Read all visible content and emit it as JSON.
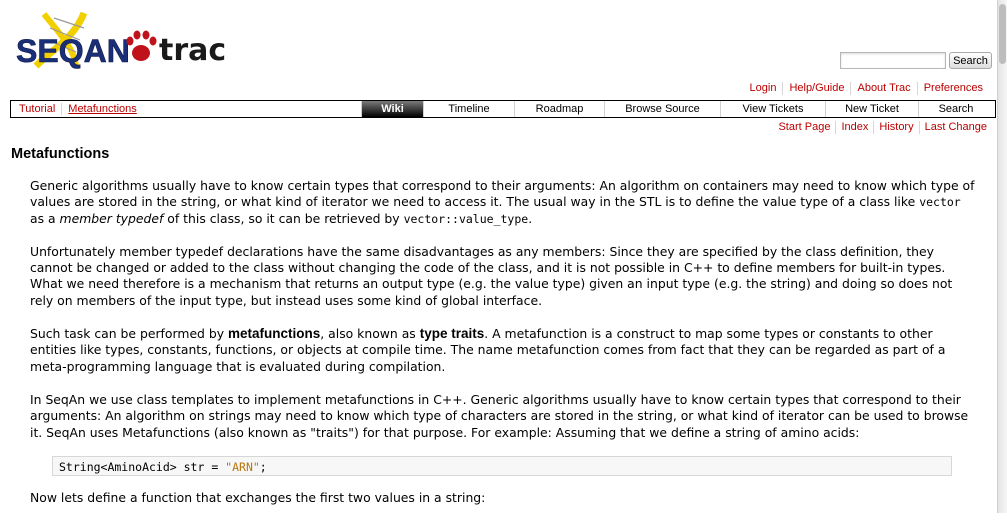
{
  "logo": {
    "text_seqan": "SEQAN",
    "text_trac": "trac"
  },
  "search": {
    "placeholder": "",
    "button_label": "Search"
  },
  "metanav": [
    "Login",
    "Help/Guide",
    "About Trac",
    "Preferences"
  ],
  "mainnav": {
    "left_links": [
      "Tutorial",
      "Metafunctions"
    ],
    "items": [
      {
        "label": "Wiki",
        "active": true
      },
      {
        "label": "Timeline",
        "active": false
      },
      {
        "label": "Roadmap",
        "active": false
      },
      {
        "label": "Browse Source",
        "active": false
      },
      {
        "label": "View Tickets",
        "active": false
      },
      {
        "label": "New Ticket",
        "active": false
      },
      {
        "label": "Search",
        "active": false
      }
    ]
  },
  "ctxtnav": [
    "Start Page",
    "Index",
    "History",
    "Last Change"
  ],
  "page": {
    "title": "Metafunctions",
    "p1_a": "Generic algorithms usually have to know certain types that correspond to their arguments: An algorithm on containers may need to know which type of values are stored in the string, or what kind of iterator we need to access it. The usual way in the STL is to define the value type of a class like ",
    "p1_code1": "vector",
    "p1_b": " as a ",
    "p1_em": "member typedef",
    "p1_c": " of this class, so it can be retrieved by ",
    "p1_code2": "vector::value_type",
    "p1_d": ".",
    "p2": "Unfortunately member typedef declarations have the same disadvantages as any members: Since they are specified by the class definition, they cannot be changed or added to the class without changing the code of the class, and it is not possible in C++ to define members for built-in types. What we need therefore is a mechanism that returns an output type (e.g. the value type) given an input type (e.g. the string) and doing so does not rely on members of the input type, but instead uses some kind of global interface.",
    "p3_a": "Such task can be performed by ",
    "p3_b1": "metafunctions",
    "p3_b": ", also known as ",
    "p3_b2": "type traits",
    "p3_c": ". A metafunction is a construct to map some types or constants to other entities like types, constants, functions, or objects at compile time. The name metafunction comes from fact that they can be regarded as part of a meta-programming language that is evaluated during compilation.",
    "p4": "In SeqAn we use class templates to implement metafunctions in C++. Generic algorithms usually have to know certain types that correspond to their arguments: An algorithm on strings may need to know which type of characters are stored in the string, or what kind of iterator can be used to browse it. SeqAn uses Metafunctions (also known as \"traits\") for that purpose. For example: Assuming that we define a string of amino acids:",
    "code_a": "String<AminoAcid> str = ",
    "code_str": "\"ARN\"",
    "code_b": ";",
    "p5": "Now lets define a function that exchanges the first two values in a string:"
  },
  "colors": {
    "link": "#bb0000",
    "logo_yellow": "#f2d000",
    "logo_blue": "#1a2f78",
    "logo_red": "#c0121a"
  }
}
